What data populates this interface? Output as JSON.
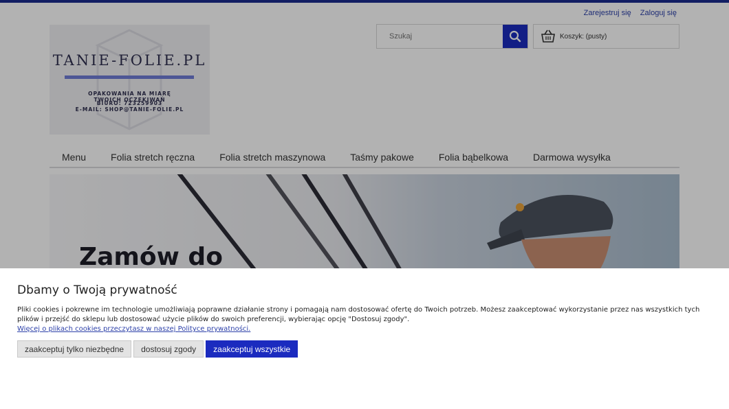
{
  "header": {
    "register_label": "Zarejestruj się",
    "login_label": "Zaloguj się"
  },
  "logo": {
    "title": "TANIE-FOLIE.PL",
    "tagline_line1": "OPAKOWANIA NA MIARĘ",
    "tagline_line2": "TWOICH OCZEKIWAŃ",
    "phone_line": "BIURO: 723259903",
    "email_line": "E-MAIL: SHOP@TANIE-FOLIE.PL"
  },
  "search": {
    "placeholder": "Szukaj",
    "icon": "search-icon"
  },
  "cart": {
    "label": "Koszyk: (pusty)",
    "icon": "basket-icon"
  },
  "nav": {
    "items": [
      {
        "label": "Menu"
      },
      {
        "label": "Folia stretch ręczna"
      },
      {
        "label": "Folia stretch maszynowa"
      },
      {
        "label": "Taśmy pakowe"
      },
      {
        "label": "Folia bąbelkowa"
      },
      {
        "label": "Darmowa wysyłka"
      }
    ]
  },
  "banner": {
    "headline": "Zamów do"
  },
  "cookie": {
    "title": "Dbamy o Twoją prywatność",
    "text": "Pliki cookies i pokrewne im technologie umożliwiają poprawne działanie strony i pomagają nam dostosować ofertę do Twoich potrzeb. Możesz zaakceptować wykorzystanie przez nas wszystkich tych plików i przejść do sklepu lub dostosować użycie plików do swoich preferencji, wybierając opcję \"Dostosuj zgody\".",
    "link": "Więcej o plikach cookies przeczytasz w naszej Polityce prywatności.",
    "btn_necessary": "zaakceptuj tylko niezbędne",
    "btn_customize": "dostosuj zgody",
    "btn_accept_all": "zaakceptuj wszystkie"
  },
  "colors": {
    "accent": "#1b2bbf",
    "top_bar": "#1b2b8f",
    "link": "#2b3fa8"
  }
}
